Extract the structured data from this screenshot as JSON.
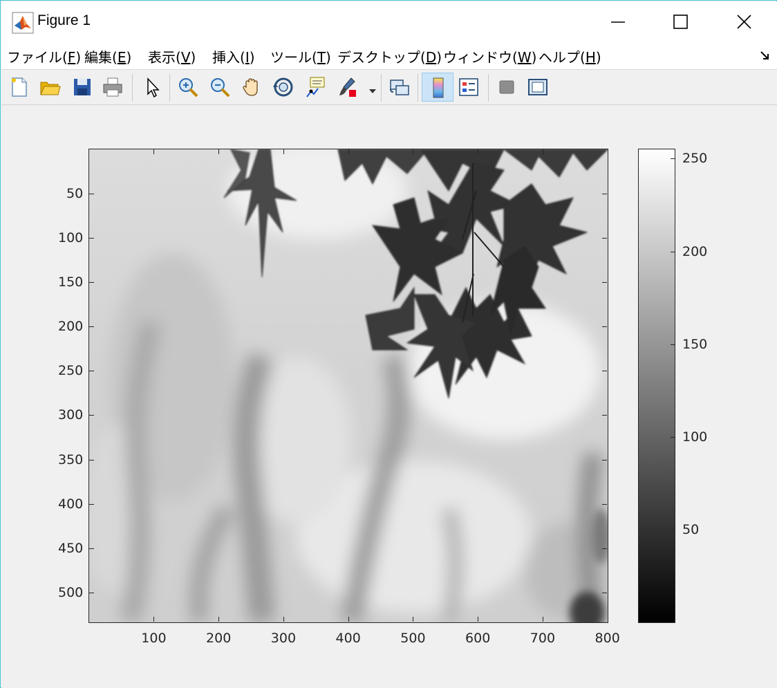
{
  "window": {
    "title": "Figure 1",
    "border_color": "#47c9d6",
    "controls": [
      "minimize-icon",
      "maximize-icon",
      "close-icon"
    ]
  },
  "menu": {
    "items": [
      {
        "label": "ファイル(",
        "accel": "F",
        "tail": ")"
      },
      {
        "label": "編集(",
        "accel": "E",
        "tail": ")"
      },
      {
        "label": "表示(",
        "accel": "V",
        "tail": ")"
      },
      {
        "label": "挿入(",
        "accel": "I",
        "tail": ")"
      },
      {
        "label": "ツール(",
        "accel": "T",
        "tail": ")"
      },
      {
        "label": "デスクトップ(",
        "accel": "D",
        "tail": ")"
      },
      {
        "label": "ウィンドウ(",
        "accel": "W",
        "tail": ")"
      },
      {
        "label": "ヘルプ(",
        "accel": "H",
        "tail": ")"
      }
    ]
  },
  "toolbar": {
    "buttons": [
      "new-figure-icon",
      "open-file-icon",
      "save-icon",
      "print-icon",
      "edit-plot-icon",
      "zoom-in-icon",
      "zoom-out-icon",
      "pan-icon",
      "rotate-3d-icon",
      "data-cursor-icon",
      "brush-icon",
      "link-plot-icon",
      "colorbar-icon",
      "legend-icon",
      "hide-plot-tools-icon",
      "show-plot-tools-icon"
    ],
    "active": "colorbar-icon",
    "brush_color": "#e8001c"
  },
  "axes": {
    "x_ticks": [
      "100",
      "200",
      "300",
      "400",
      "500",
      "600",
      "700",
      "800"
    ],
    "y_ticks": [
      "50",
      "100",
      "150",
      "200",
      "250",
      "300",
      "350",
      "400",
      "450",
      "500"
    ],
    "x_range": [
      0.5,
      800.5
    ],
    "y_range": [
      0.5,
      533.5
    ],
    "y_direction": "reverse",
    "colormap": "gray"
  },
  "colorbar": {
    "ticks": [
      "50",
      "100",
      "150",
      "200",
      "250"
    ],
    "range": [
      0,
      255
    ]
  },
  "image": {
    "description_hidden": true,
    "content": "grayscale maple leaves"
  }
}
